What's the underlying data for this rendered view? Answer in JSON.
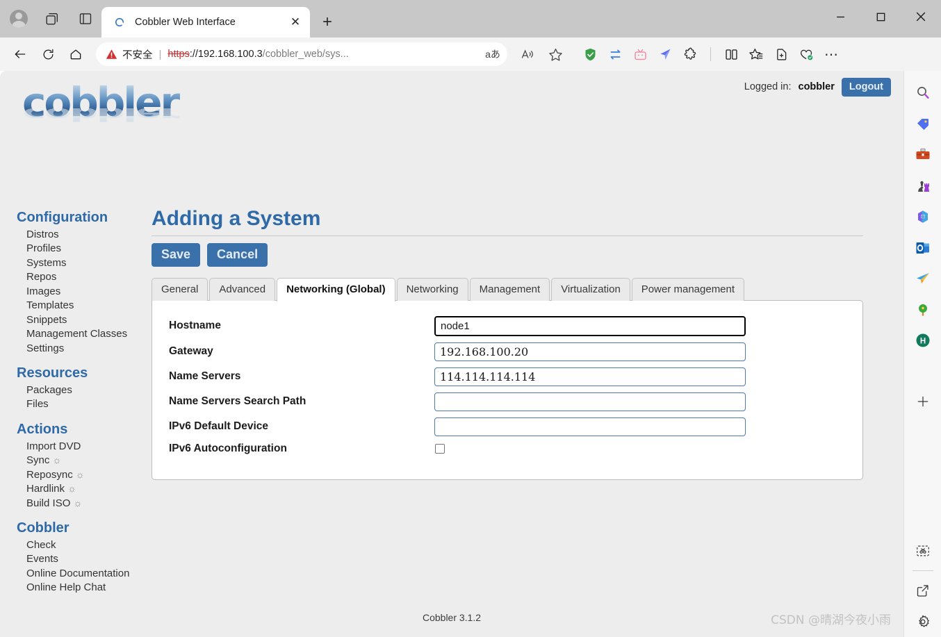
{
  "browser": {
    "tab": {
      "title": "Cobbler Web Interface",
      "favicon": "cobbler-loading-icon",
      "close_label": "✕"
    },
    "new_tab_label": "+",
    "window_controls": {
      "minimize": "—",
      "maximize": "□",
      "close": "✕"
    },
    "toolbar": {
      "back_label": "←",
      "reload_label": "↻",
      "home_label": "⌂",
      "security_warning": "不安全",
      "url_scheme": "https",
      "url_rest": "://192.168.100.3/cobbler_web/sys...",
      "url_host": "://192.168.100.3",
      "url_path": "/cobbler_web/sys...",
      "translate_label": "aあ",
      "read_aloud_label": "A",
      "favorite_label": "☆",
      "more_label": "⋯"
    },
    "extensions": [
      {
        "name": "adguard-shield-icon",
        "color": "#3a9e4a"
      },
      {
        "name": "sync-arrows-icon",
        "color": "#3b7fe0"
      },
      {
        "name": "tv-icon",
        "color": "#f08ea8"
      },
      {
        "name": "kite-icon",
        "color": "#4a63e8"
      },
      {
        "name": "puzzle-piece-icon",
        "color": "#2b2b2b"
      },
      {
        "name": "split-screen-icon",
        "color": "#2b2b2b"
      },
      {
        "name": "collections-icon",
        "color": "#2b2b2b"
      },
      {
        "name": "add-to-collection-icon",
        "color": "#2b2b2b"
      },
      {
        "name": "browser-essentials-icon",
        "color": "#2b2b2b"
      }
    ],
    "sidebar_icons": [
      {
        "name": "search-icon"
      },
      {
        "name": "shopping-tag-icon"
      },
      {
        "name": "toolbox-icon"
      },
      {
        "name": "games-icon"
      },
      {
        "name": "microsoft-365-icon"
      },
      {
        "name": "outlook-icon"
      },
      {
        "name": "telegram-icon"
      },
      {
        "name": "tree-icon"
      },
      {
        "name": "h-circle-icon"
      },
      {
        "name": "add-icon"
      },
      {
        "name": "screenshot-icon"
      },
      {
        "name": "open-in-new-icon"
      },
      {
        "name": "settings-gear-icon"
      }
    ]
  },
  "auth": {
    "logged_in_prefix": "Logged in:",
    "username": "cobbler",
    "logout_label": "Logout"
  },
  "logo": {
    "text": "cobbler"
  },
  "sidebar": {
    "groups": [
      {
        "heading": "Configuration",
        "items": [
          {
            "label": "Distros",
            "gear": false
          },
          {
            "label": "Profiles",
            "gear": false
          },
          {
            "label": "Systems",
            "gear": false
          },
          {
            "label": "Repos",
            "gear": false
          },
          {
            "label": "Images",
            "gear": false
          },
          {
            "label": "Templates",
            "gear": false
          },
          {
            "label": "Snippets",
            "gear": false
          },
          {
            "label": "Management Classes",
            "gear": false
          },
          {
            "label": "Settings",
            "gear": false
          }
        ]
      },
      {
        "heading": "Resources",
        "items": [
          {
            "label": "Packages",
            "gear": false
          },
          {
            "label": "Files",
            "gear": false
          }
        ]
      },
      {
        "heading": "Actions",
        "items": [
          {
            "label": "Import DVD",
            "gear": false
          },
          {
            "label": "Sync",
            "gear": true
          },
          {
            "label": "Reposync",
            "gear": true
          },
          {
            "label": "Hardlink",
            "gear": true
          },
          {
            "label": "Build ISO",
            "gear": true
          }
        ]
      },
      {
        "heading": "Cobbler",
        "items": [
          {
            "label": "Check",
            "gear": false
          },
          {
            "label": "Events",
            "gear": false
          },
          {
            "label": "Online Documentation",
            "gear": false
          },
          {
            "label": "Online Help Chat",
            "gear": false
          }
        ]
      }
    ]
  },
  "main": {
    "title": "Adding a System",
    "save_label": "Save",
    "cancel_label": "Cancel",
    "tabs": [
      {
        "label": "General",
        "active": false
      },
      {
        "label": "Advanced",
        "active": false
      },
      {
        "label": "Networking (Global)",
        "active": true
      },
      {
        "label": "Networking",
        "active": false
      },
      {
        "label": "Management",
        "active": false
      },
      {
        "label": "Virtualization",
        "active": false
      },
      {
        "label": "Power management",
        "active": false
      }
    ],
    "fields": [
      {
        "label": "Hostname",
        "type": "text",
        "value": "node1",
        "placeholder": "",
        "focused": true
      },
      {
        "label": "Gateway",
        "type": "text",
        "value": "192.168.100.20",
        "placeholder": "",
        "focused": false
      },
      {
        "label": "Name Servers",
        "type": "text",
        "value": "114.114.114.114",
        "placeholder": "",
        "focused": false
      },
      {
        "label": "Name Servers Search Path",
        "type": "text",
        "value": "",
        "placeholder": "",
        "focused": false
      },
      {
        "label": "IPv6 Default Device",
        "type": "text",
        "value": "",
        "placeholder": "",
        "focused": false
      },
      {
        "label": "IPv6 Autoconfiguration",
        "type": "checkbox",
        "value": "",
        "checked": false,
        "focused": false
      }
    ]
  },
  "footer": {
    "version": "Cobbler 3.1.2"
  },
  "watermark": {
    "text": "CSDN @晴湖今夜小雨"
  },
  "colors": {
    "accent": "#3a71ab",
    "heading": "#2f6aa8",
    "page_bg": "#ededed",
    "panel_bg": "#ffffff",
    "input_border": "#4a7ab0"
  }
}
